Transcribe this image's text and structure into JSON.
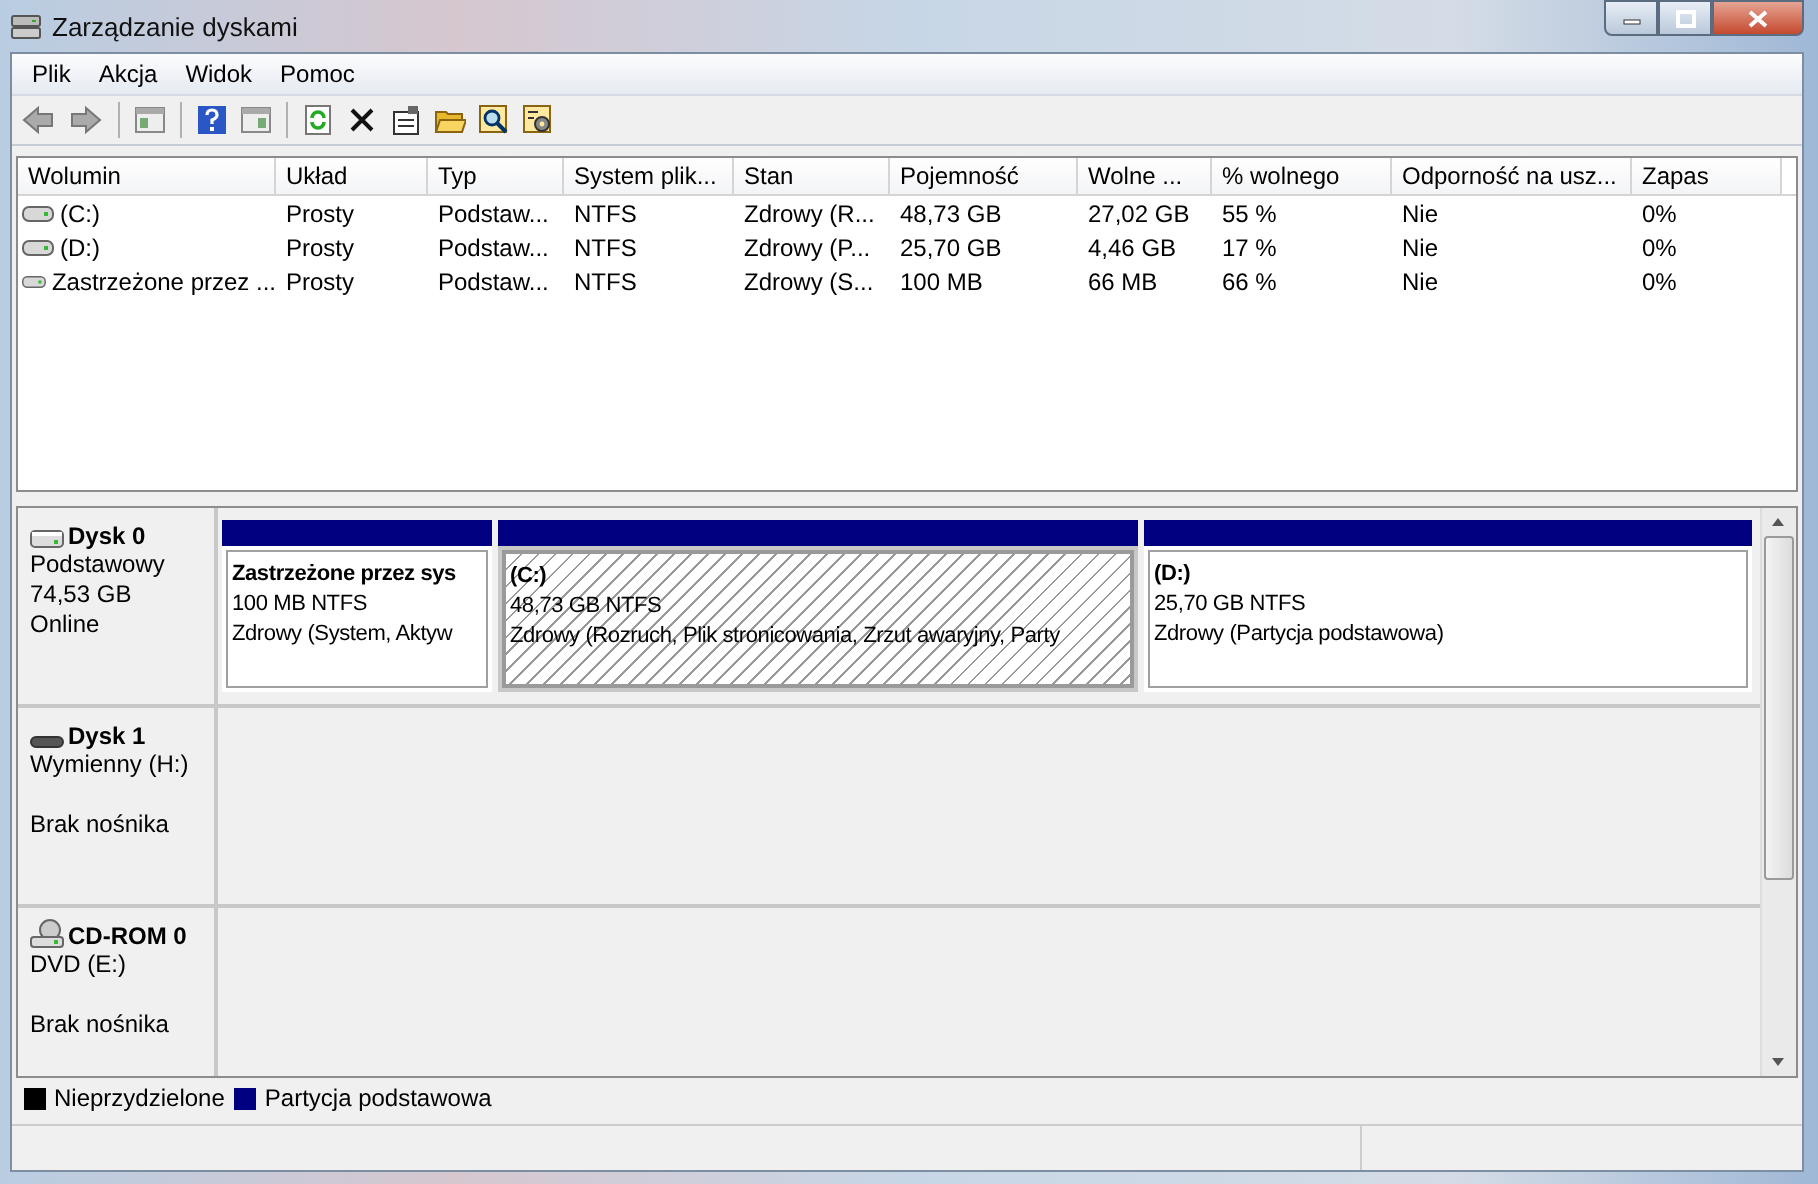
{
  "window": {
    "title": "Zarządzanie dyskami"
  },
  "menu": [
    "Plik",
    "Akcja",
    "Widok",
    "Pomoc"
  ],
  "table": {
    "columns": [
      "Wolumin",
      "Układ",
      "Typ",
      "System plik...",
      "Stan",
      "Pojemność",
      "Wolne ...",
      "% wolnego",
      "Odporność na usz...",
      "Zapas"
    ],
    "rows": [
      {
        "kind": "drive",
        "cells": [
          "(C:)",
          "Prosty",
          "Podstaw...",
          "NTFS",
          "Zdrowy (R...",
          "48,73 GB",
          "27,02 GB",
          "55 %",
          "Nie",
          "0%"
        ]
      },
      {
        "kind": "drive",
        "cells": [
          "(D:)",
          "Prosty",
          "Podstaw...",
          "NTFS",
          "Zdrowy (P...",
          "25,70 GB",
          "4,46 GB",
          "17 %",
          "Nie",
          "0%"
        ]
      },
      {
        "kind": "drive",
        "cells": [
          "Zastrzeżone przez ...",
          "Prosty",
          "Podstaw...",
          "NTFS",
          "Zdrowy (S...",
          "100 MB",
          "66 MB",
          "66 %",
          "Nie",
          "0%"
        ]
      }
    ]
  },
  "disks": [
    {
      "kind": "hdd",
      "name": "Dysk 0",
      "type": "Podstawowy",
      "size": "74,53 GB",
      "status": "Online",
      "partitions": [
        {
          "name": "Zastrzeżone przez sys",
          "size": "100 MB NTFS",
          "status": "Zdrowy (System, Aktyw",
          "selected": false
        },
        {
          "name": "(C:)",
          "size": "48,73 GB NTFS",
          "status": "Zdrowy (Rozruch, Plik stronicowania, Zrzut awaryjny, Party",
          "selected": true
        },
        {
          "name": "(D:)",
          "size": "25,70 GB NTFS",
          "status": "Zdrowy (Partycja podstawowa)",
          "selected": false
        }
      ]
    },
    {
      "kind": "removable",
      "name": "Dysk 1",
      "type": "Wymienny (H:)",
      "status": "Brak nośnika"
    },
    {
      "kind": "cdrom",
      "name": "CD-ROM 0",
      "type": "DVD (E:)",
      "status": "Brak nośnika"
    }
  ],
  "legend": [
    {
      "label": "Nieprzydzielone",
      "color": "#000000"
    },
    {
      "label": "Partycja podstawowa",
      "color": "#000080"
    }
  ]
}
